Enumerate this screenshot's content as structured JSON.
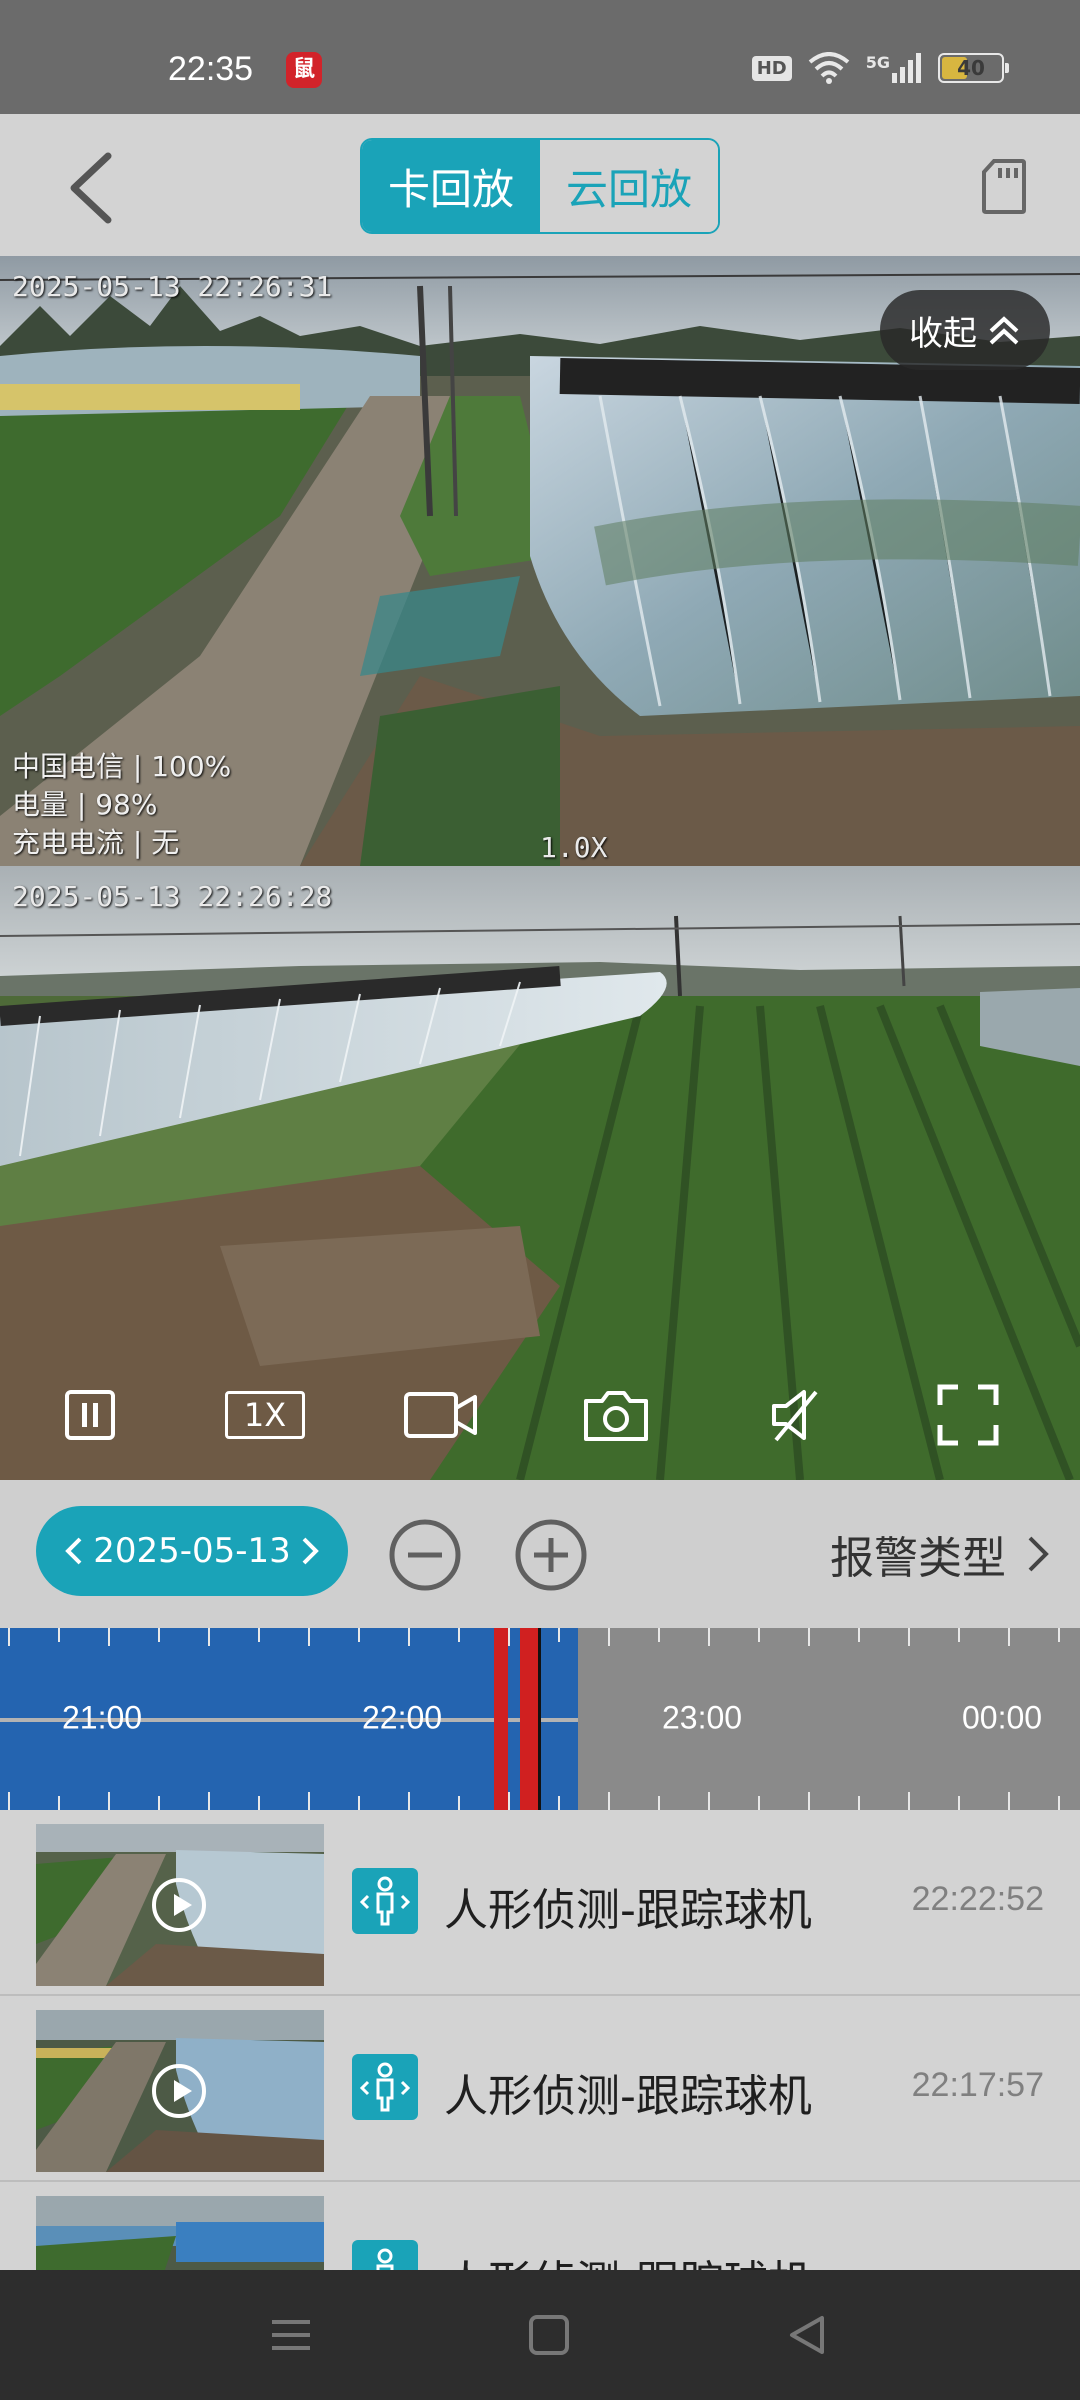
{
  "status_bar": {
    "time": "22:35",
    "app_badge": "鼠",
    "hd": "HD",
    "network": "5G",
    "battery_level": "40"
  },
  "header": {
    "tabs": [
      {
        "label": "卡回放",
        "active": true
      },
      {
        "label": "云回放",
        "active": false
      }
    ],
    "back_icon": "chevron-left-icon",
    "sd_card_icon": "sd-card-icon"
  },
  "video1": {
    "timestamp": "2025-05-13 22:26:31",
    "collapse_label": "收起",
    "carrier_info": "中国电信 | 100%",
    "battery_info": "电量 | 98%",
    "charging_info": "充电电流 | 无",
    "zoom_level": "1.0X"
  },
  "video2": {
    "timestamp": "2025-05-13 22:26:28",
    "speed_label": "1X"
  },
  "date_bar": {
    "date": "2025-05-13",
    "alarm_type_label": "报警类型"
  },
  "timeline": {
    "labels": [
      "21:00",
      "22:00",
      "23:00",
      "00:00"
    ]
  },
  "events": [
    {
      "title": "人形侦测-跟踪球机",
      "time": "22:22:52"
    },
    {
      "title": "人形侦测-跟踪球机",
      "time": "22:17:57"
    },
    {
      "title": "人形侦测-跟踪球机",
      "time": ""
    }
  ],
  "colors": {
    "accent": "#1aa3b8",
    "timeline_recorded": "#2464b0",
    "alarm_marker": "#d02020"
  }
}
